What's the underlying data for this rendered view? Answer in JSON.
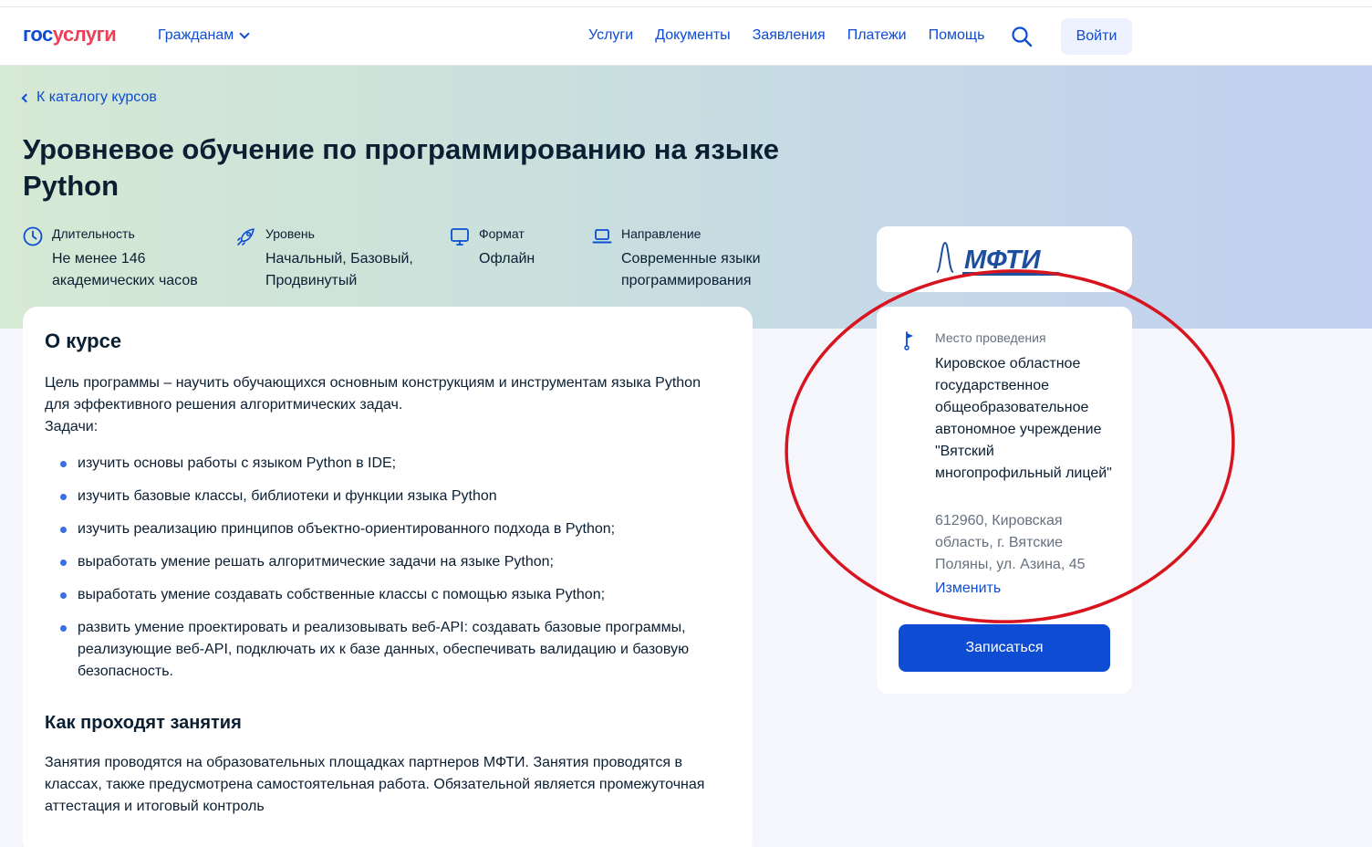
{
  "header": {
    "logo_part1": "гос",
    "logo_part2": "услуги",
    "audience": "Гражданам",
    "nav": [
      "Услуги",
      "Документы",
      "Заявления",
      "Платежи",
      "Помощь"
    ],
    "login": "Войти"
  },
  "hero": {
    "back_link": "К каталогу курсов",
    "title": "Уровневое обучение по программированию на языке Python",
    "meta": [
      {
        "label": "Длительность",
        "value": "Не менее 146 академических часов",
        "icon": "clock-icon"
      },
      {
        "label": "Уровень",
        "value": "Начальный, Базовый, Продвинутый",
        "icon": "rocket-icon"
      },
      {
        "label": "Формат",
        "value": "Офлайн",
        "icon": "monitor-icon"
      },
      {
        "label": "Направление",
        "value": "Современные языки программирования",
        "icon": "laptop-icon"
      }
    ]
  },
  "about": {
    "heading": "О курсе",
    "goal": "Цель программы – научить обучающихся основным конструкциям и инструментам языка Python для эффективного решения алгоритмических задач.",
    "tasks_label": "Задачи:",
    "tasks": [
      "изучить основы работы с языком Python в IDE;",
      "изучить базовые классы, библиотеки и функции языка Python",
      "изучить реализацию принципов объектно-ориентированного подхода в Python;",
      "выработать умение решать алгоритмические задачи на языке Python;",
      "выработать умение создавать собственные классы с помощью языка Python;",
      "развить умение проектировать и реализовывать веб-API: создавать базовые программы, реализующие веб-API, подключать их к базе данных, обеспечивать валидацию и базовую безопасность."
    ],
    "how_heading": "Как проходят занятия",
    "how_text": "Занятия проводятся на образовательных площадках партнеров МФТИ. Занятия проводятся в классах, также предусмотрена самостоятельная работа. Обязательной является промежуточная аттестация и итоговый контроль"
  },
  "provider": {
    "logo_text": "МФТИ"
  },
  "place": {
    "label": "Место проведения",
    "name": "Кировское областное государственное общеобразовательное автономное учреждение \"Вятский многопрофильный лицей\"",
    "address": "612960, Кировская область, г. Вятские Поляны, ул. Азина, 45",
    "change": "Изменить",
    "signup": "Записаться"
  },
  "colors": {
    "accent": "#0d4cd3",
    "brand_red": "#ee3f58",
    "annotation": "#d8141f"
  }
}
